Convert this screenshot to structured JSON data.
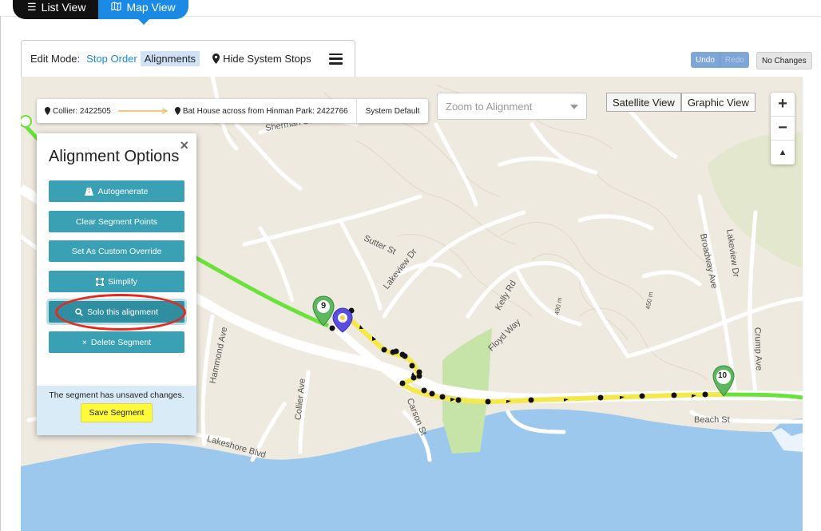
{
  "view_toggle": {
    "list_label": "List View",
    "map_label": "Map View"
  },
  "edit_bar": {
    "label": "Edit Mode:",
    "stop_order": "Stop Order",
    "alignments": "Alignments",
    "hide_system_stops": "Hide System Stops"
  },
  "undo": {
    "undo": "Undo",
    "redo": "Redo",
    "no_changes": "No Changes"
  },
  "route_bar": {
    "from": "Collier: 2422505",
    "to": "Bat House across from Hinman Park: 2422766",
    "mode": "System Default"
  },
  "zoom_select": {
    "placeholder": "Zoom to Alignment"
  },
  "map_type": {
    "satellite": "Satellite View",
    "graphic": "Graphic View"
  },
  "zoom": {
    "in": "+",
    "out": "−",
    "north": "▲"
  },
  "map_labels": {
    "sherman": "Sherman St",
    "sutter": "Sutter St",
    "lakeview_dr": "Lakeview Dr",
    "lakeview_dr2": "Lakeview Dr",
    "kelly": "Kelly Rd",
    "floyd": "Floyd Way",
    "broadway": "Broadway Ave",
    "crump": "Crump Ave",
    "hammond": "Hammond Ave",
    "collier": "Collier Ave",
    "carson": "Carson St",
    "beach": "Beach St",
    "lakeshore": "Lakeshore Blvd",
    "e490": "490 m",
    "e450": "450 m"
  },
  "markers": {
    "stop9": "9",
    "stop10": "10"
  },
  "panel": {
    "title": "Alignment Options",
    "close": "×",
    "autogenerate": "Autogenerate",
    "clear": "Clear Segment Points",
    "custom": "Set As Custom Override",
    "simplify": "Simplify",
    "solo": "Solo this alignment",
    "delete": "Delete Segment",
    "unsaved": "The segment has unsaved changes.",
    "save": "Save Segment"
  },
  "colors": {
    "accent": "#1a8ae5",
    "panel_button": "#3aa0b3",
    "route_green": "#6be23a",
    "route_yellow": "#f4e84a",
    "water": "#9dc8ee",
    "annotation": "#e8281e"
  }
}
